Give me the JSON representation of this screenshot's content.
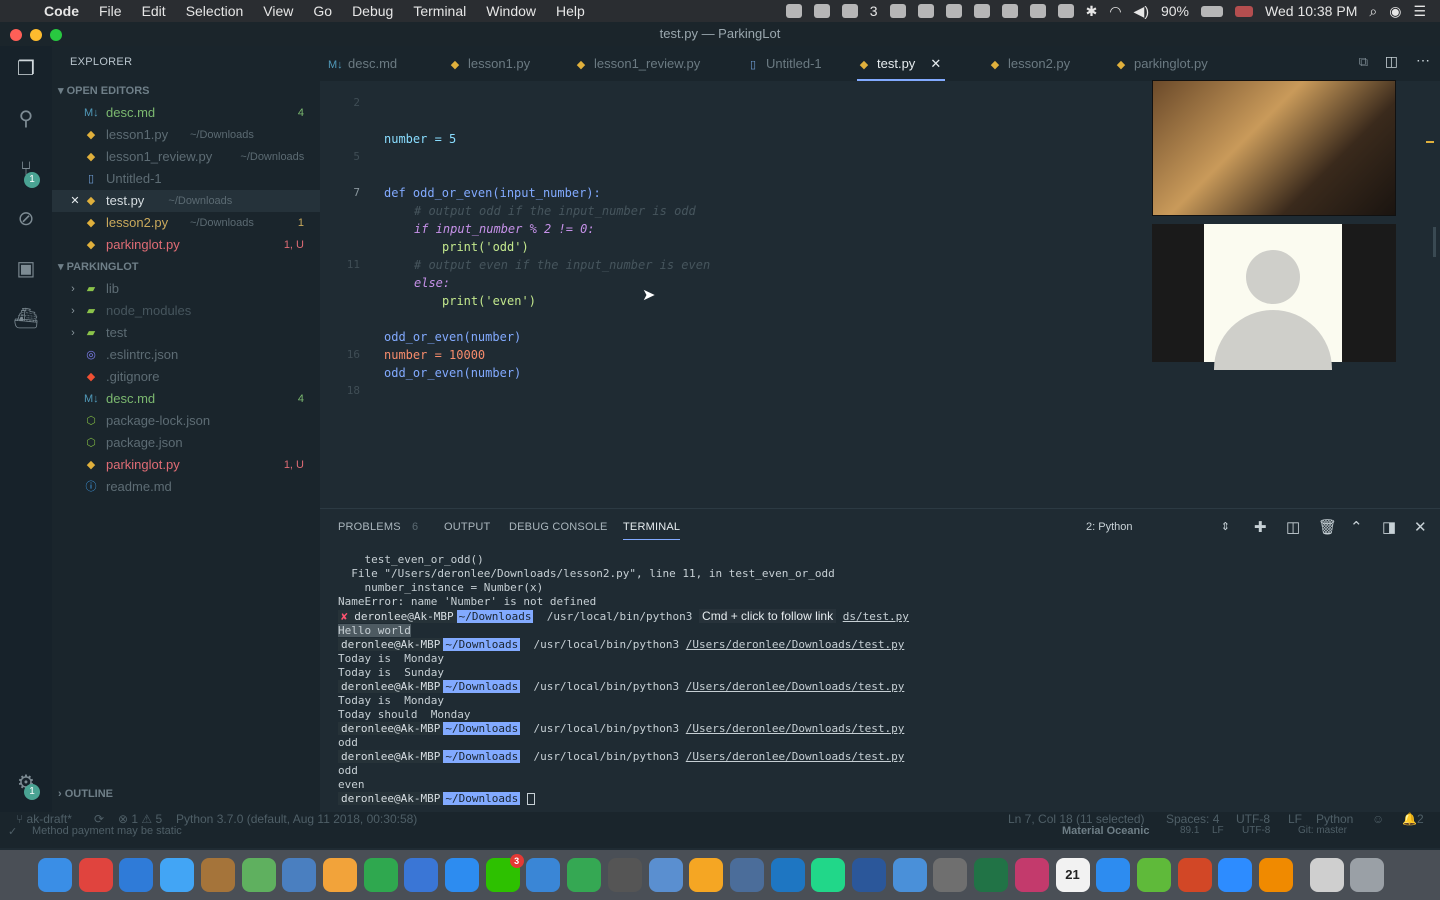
{
  "menubar": {
    "app": "Code",
    "items": [
      "File",
      "Edit",
      "Selection",
      "View",
      "Go",
      "Debug",
      "Terminal",
      "Window",
      "Help"
    ],
    "wechat_count": "3",
    "battery": "90%",
    "datetime": "Wed 10:38 PM"
  },
  "window": {
    "title": "test.py — ParkingLot"
  },
  "sidebar": {
    "title": "EXPLORER",
    "open_editors_label": "OPEN EDITORS",
    "open_editors": [
      {
        "icon": "markdown-icon",
        "label": "desc.md",
        "path": "",
        "badge": "4",
        "color": "#7bb86f"
      },
      {
        "icon": "python-icon",
        "label": "lesson1.py",
        "path": "~/Downloads",
        "badge": "",
        "color": "#5d6c74"
      },
      {
        "icon": "python-icon",
        "label": "lesson1_review.py",
        "path": "~/Downloads",
        "badge": "",
        "color": "#5d6c74"
      },
      {
        "icon": "file-icon",
        "label": "Untitled-1",
        "path": "",
        "badge": "",
        "color": "#5d6c74"
      },
      {
        "icon": "python-icon",
        "label": "test.py",
        "path": "~/Downloads",
        "badge": "",
        "color": "#d6dde1"
      },
      {
        "icon": "python-icon",
        "label": "lesson2.py",
        "path": "~/Downloads",
        "badge": "1",
        "color": "#c9a95c"
      },
      {
        "icon": "python-icon",
        "label": "parkinglot.py",
        "path": "",
        "badge": "1, U",
        "color": "#e06c75"
      }
    ],
    "project_label": "PARKINGLOT",
    "project": [
      {
        "icon": "folder-icon",
        "label": "lib",
        "folder": true,
        "badge": "",
        "color": "#5d6c74"
      },
      {
        "icon": "folder-icon",
        "label": "node_modules",
        "folder": true,
        "badge": "",
        "color": "#46555d"
      },
      {
        "icon": "folder-icon",
        "label": "test",
        "folder": true,
        "badge": "",
        "color": "#5d6c74"
      },
      {
        "icon": "eslint-icon",
        "label": ".eslintrc.json",
        "folder": false,
        "badge": "",
        "color": "#5d6c74"
      },
      {
        "icon": "git-icon",
        "label": ".gitignore",
        "folder": false,
        "badge": "",
        "color": "#5d6c74"
      },
      {
        "icon": "markdown-icon",
        "label": "desc.md",
        "folder": false,
        "badge": "4",
        "color": "#7bb86f"
      },
      {
        "icon": "node-icon",
        "label": "package-lock.json",
        "folder": false,
        "badge": "",
        "color": "#5d6c74"
      },
      {
        "icon": "node-icon",
        "label": "package.json",
        "folder": false,
        "badge": "",
        "color": "#5d6c74"
      },
      {
        "icon": "python-icon",
        "label": "parkinglot.py",
        "folder": false,
        "badge": "1, U",
        "color": "#e06c75"
      },
      {
        "icon": "info-icon",
        "label": "readme.md",
        "folder": false,
        "badge": "",
        "color": "#5d6c74"
      }
    ],
    "outline_label": "OUTLINE",
    "settings_badge": "1",
    "scm_badge": "1"
  },
  "tabs": [
    {
      "label": "desc.md",
      "icon": "markdown-icon",
      "active": false
    },
    {
      "label": "lesson1.py",
      "icon": "python-icon",
      "active": false
    },
    {
      "label": "lesson1_review.py",
      "icon": "python-icon",
      "active": false
    },
    {
      "label": "Untitled-1",
      "icon": "file-icon",
      "active": false
    },
    {
      "label": "test.py",
      "icon": "python-icon",
      "active": true
    },
    {
      "label": "lesson2.py",
      "icon": "python-icon",
      "active": false
    },
    {
      "label": "parkinglot.py",
      "icon": "python-icon",
      "active": false
    }
  ],
  "editor": {
    "line_numbers": [
      "2",
      "",
      "",
      "5",
      "",
      "7",
      "",
      "",
      "",
      "11",
      "",
      "",
      "",
      "",
      "16",
      "",
      "18"
    ],
    "code": {
      "l1": "number = 5",
      "l2": "def odd_or_even(input_number):",
      "l3": "# output odd if the input_number is odd",
      "l4": "if input_number % 2 != 0:",
      "l5": "print('odd')",
      "l6": "# output even if the input_number is even",
      "l7": "else:",
      "l8": "print('even')",
      "l9": "odd_or_even(number)",
      "l10": "number = 10000",
      "l11": "odd_or_even(number)"
    }
  },
  "panel": {
    "tabs": {
      "problems": "PROBLEMS",
      "problems_count": "6",
      "output": "OUTPUT",
      "debug": "DEBUG CONSOLE",
      "terminal": "TERMINAL"
    },
    "shell_select": "2: Python",
    "user": "deronlee@Ak-MBP",
    "dir": "~/Downloads",
    "python": "/usr/local/bin/python3",
    "script": "/Users/deronlee/Downloads/test.py",
    "tooltip": "Cmd + click to follow link",
    "script_tail": "ds/test.py",
    "x_mark": "✘",
    "lines": {
      "t1": "    test_even_or_odd()",
      "t2": "  File \"/Users/deronlee/Downloads/lesson2.py\", line 11, in test_even_or_odd",
      "t3": "    number_instance = Number(x)",
      "t4": "NameError: name 'Number' is not defined",
      "o1": "Hello world",
      "o2": "Today is  Monday",
      "o3": "Today is  Sunday",
      "o4": "Today is  Monday",
      "o5": "Today should  Monday",
      "o6": "odd",
      "o7": "odd",
      "o8": "even"
    }
  },
  "status": {
    "branch": "ak-draft*",
    "errors": "1",
    "warnings": "5",
    "interpreter": "Python 3.7.0 (default, Aug 11 2018, 00:30:58)",
    "cursor": "Ln 7, Col 18 (11 selected)",
    "spaces": "Spaces: 4",
    "encoding": "UTF-8",
    "eol": "LF",
    "language": "Python",
    "bell": "2",
    "method_text": "Method payment may be static",
    "theme": "Material Oceanic",
    "theme_num": "89.1",
    "lf2": "LF",
    "enc2": "UTF-8",
    "git": "Git: master"
  },
  "dock": [
    "finder",
    "chrome",
    "safari",
    "messages",
    "notes",
    "maps",
    "preview",
    "pages",
    "numbers",
    "keynote",
    "appstore",
    "wechat",
    "xcode",
    "evernote",
    "sublime",
    "mail",
    "sketch",
    "instruments",
    "vscode",
    "pycharm",
    "word",
    "xcode2",
    "virtualbox",
    "excel",
    "rubymine",
    "calendar",
    "markdown",
    "numbers2",
    "powerpoint",
    "zoom",
    "vlc",
    "clipboard",
    "trash"
  ],
  "dock_calendar": "21",
  "dock_wechat_badge": "3"
}
